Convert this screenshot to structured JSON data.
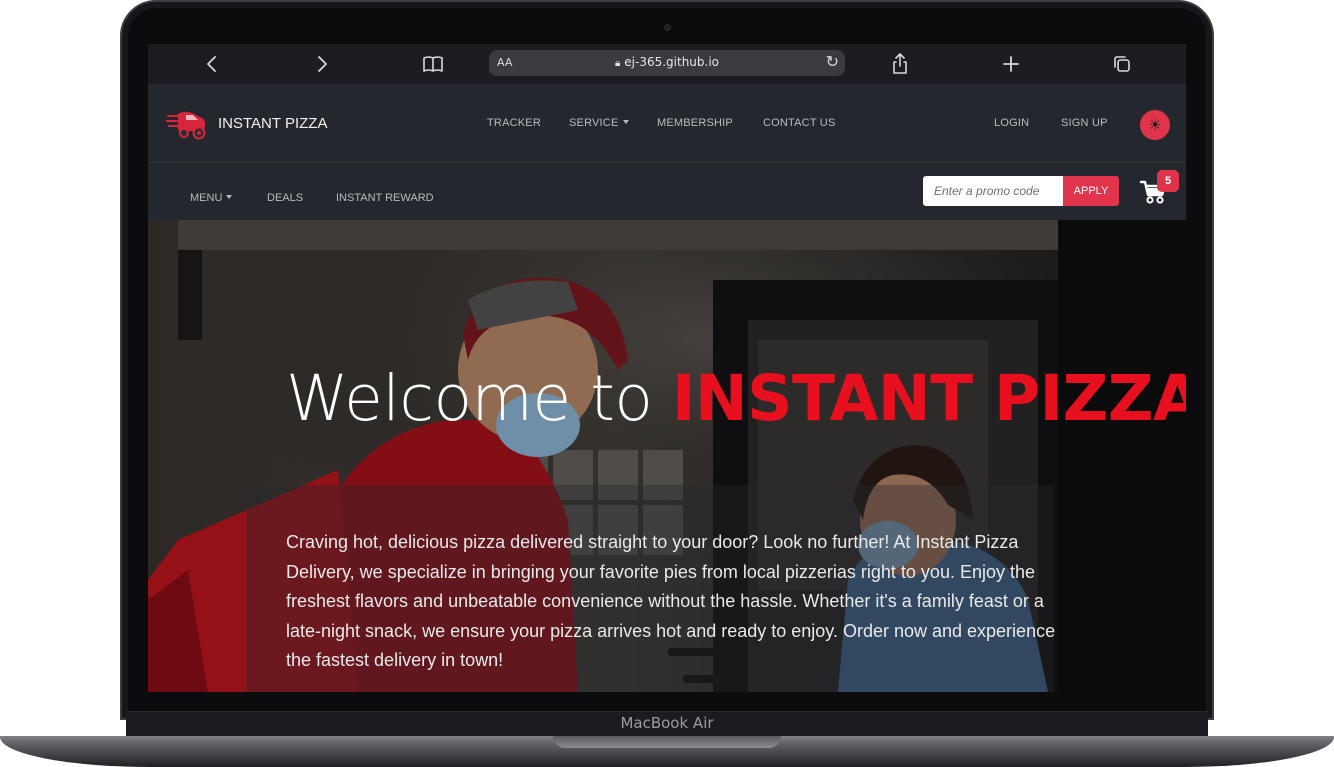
{
  "device": {
    "label": "MacBook Air"
  },
  "browser": {
    "text_size_label": "AA",
    "url": "ej-365.github.io"
  },
  "navbar": {
    "brand": "INSTANT PIZZA",
    "links": [
      "TRACKER",
      "SERVICE",
      "MEMBERSHIP",
      "CONTACT US"
    ],
    "auth": {
      "login": "LOGIN",
      "signup": "SIGN UP"
    },
    "theme_icon": "sun-icon"
  },
  "subnav": {
    "links": [
      "MENU",
      "DEALS",
      "INSTANT REWARD"
    ],
    "promo_placeholder": "Enter a promo code",
    "apply_label": "APPLY",
    "cart_count": "5"
  },
  "hero": {
    "title_prefix": "Welcome to",
    "title_accent": "INSTANT PIZZA",
    "text": "Craving hot, delicious pizza delivered straight to your door? Look no further! At Instant Pizza Delivery, we specialize in bringing your favorite pies from local pizzerias right to you. Enjoy the freshest flavors and unbeatable convenience without the hassle. Whether it's a family feast or a late-night snack, we ensure your pizza arrives hot and ready to enjoy. Order now and experience the fastest delivery in town!"
  },
  "colors": {
    "accent": "#e0344c",
    "title_accent": "#e8101e",
    "nav_bg": "#24272d"
  }
}
